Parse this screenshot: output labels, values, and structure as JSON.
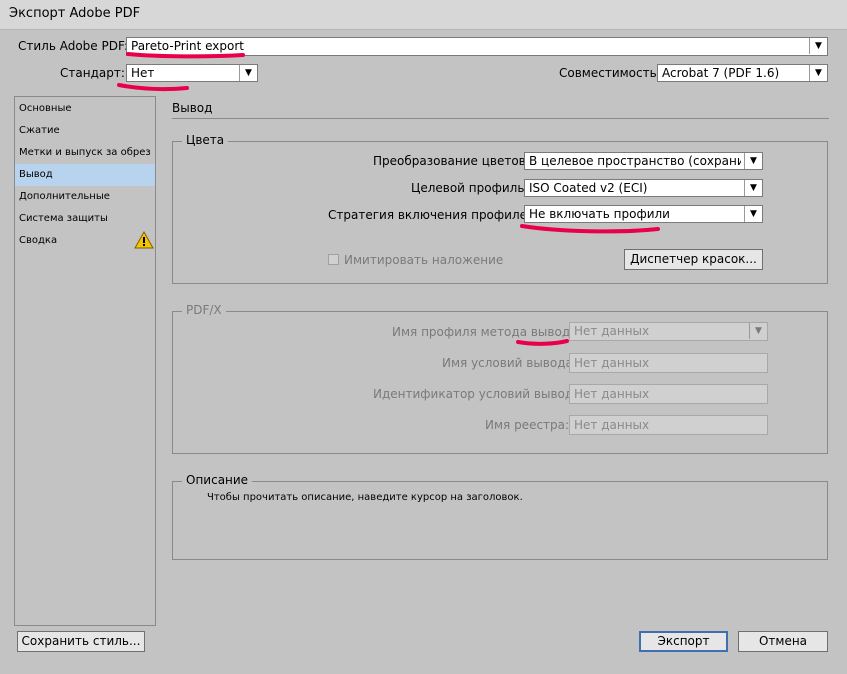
{
  "window": {
    "title": "Экспорт Adobe PDF"
  },
  "header": {
    "preset_label": "Стиль Adobe PDF:",
    "preset_value": "Pareto-Print export",
    "standard_label": "Стандарт:",
    "standard_value": "Нет",
    "compat_label": "Совместимость:",
    "compat_value": "Acrobat 7 (PDF 1.6)"
  },
  "sidebar": {
    "items": [
      {
        "label": "Основные"
      },
      {
        "label": "Сжатие"
      },
      {
        "label": "Метки и выпуск за обрез"
      },
      {
        "label": "Вывод",
        "selected": true
      },
      {
        "label": "Дополнительные"
      },
      {
        "label": "Система защиты"
      },
      {
        "label": "Сводка",
        "icon": "warning-icon"
      }
    ]
  },
  "section_title": "Вывод",
  "colors": {
    "legend": "Цвета",
    "conversion_label": "Преобразование цветов:",
    "conversion_value": "В целевое пространство (сохрани...",
    "profile_label": "Целевой профиль:",
    "profile_value": "ISO Coated v2 (ECI)",
    "inclusion_label": "Стратегия включения профилей:",
    "inclusion_value": "Не включать профили",
    "simulate_overprint_label": "Имитировать наложение",
    "ink_manager_button": "Диспетчер красок..."
  },
  "pdfx": {
    "legend": "PDF/X",
    "intent_profile_label": "Имя профиля метода вывода:",
    "intent_profile_value": "Нет данных",
    "condition_name_label": "Имя условий вывода:",
    "condition_name_value": "Нет данных",
    "condition_id_label": "Идентификатор условий вывода:",
    "condition_id_value": "Нет данных",
    "registry_label": "Имя реестра:",
    "registry_value": "Нет данных"
  },
  "description": {
    "legend": "Описание",
    "text": "Чтобы прочитать описание, наведите курсор на заголовок."
  },
  "footer": {
    "save_preset": "Сохранить стиль...",
    "export": "Экспорт",
    "cancel": "Отмена"
  },
  "colors_theme": {
    "background": "#c3c3c3",
    "selection": "#b8d3ee",
    "annotation": "#e8004a",
    "warning": "#f5c400"
  }
}
